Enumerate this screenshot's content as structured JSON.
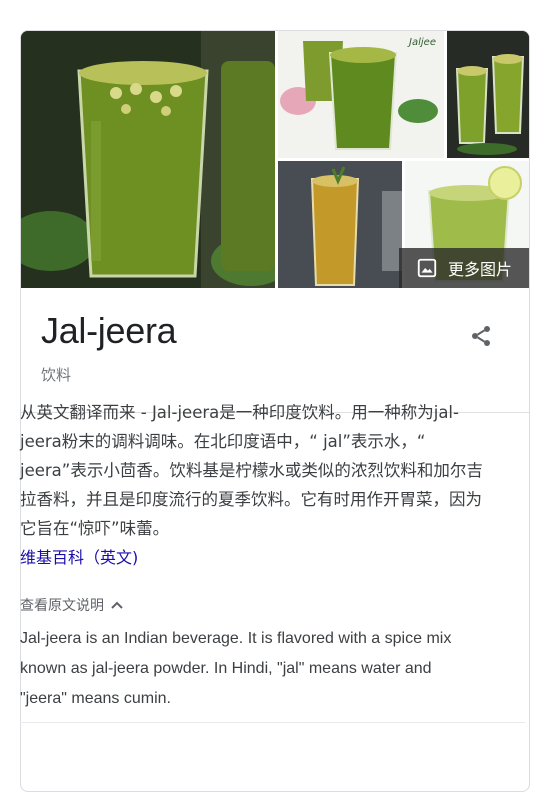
{
  "gallery": {
    "more_images_label": "更多图片",
    "thumbnail_text": "Jaljee"
  },
  "entity": {
    "title": "Jal-jeera",
    "subtitle": "饮料"
  },
  "description": {
    "text": "从英文翻译而来 - Jal-jeera是一种印度饮料。用一种称为jal-jeera粉末的调料调味。在北印度语中，“ jal”表示水，“ jeera”表示小茴香。饮料基是柠檬水或类似的浓烈饮料和加尔吉拉香料，并且是印度流行的夏季饮料。它有时用作开胃菜，因为它旨在“惊吓”味蕾。",
    "source_link": "维基百科（英文)"
  },
  "original": {
    "toggle_label": "查看原文说明",
    "text": "Jal-jeera is an Indian beverage. It is flavored with a spice mix known as jal-jeera powder. In Hindi, \"jal\" means water and \"jeera\" means cumin."
  }
}
